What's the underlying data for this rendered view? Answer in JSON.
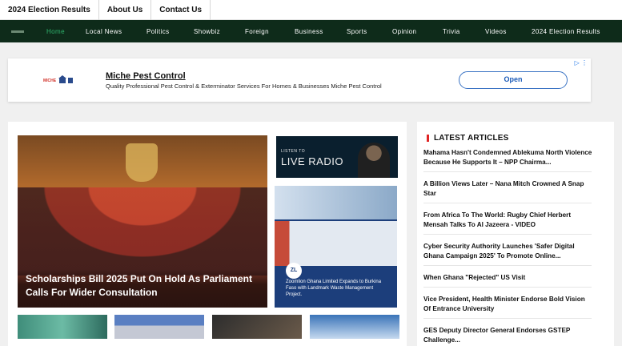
{
  "topbar": {
    "links": [
      "2024 Election Results",
      "About Us",
      "Contact Us"
    ]
  },
  "nav": {
    "items": [
      "Home",
      "Local News",
      "Politics",
      "Showbiz",
      "Foreign",
      "Business",
      "Sports",
      "Opinion",
      "Trivia",
      "Videos",
      "2024 Election Results"
    ],
    "active": "Home",
    "active_color": "#2fb46e",
    "bg_color": "#0e2b1a"
  },
  "ad": {
    "logo": "Miche Pest Control",
    "title": "Miche Pest Control",
    "text": "Quality Professional Pest Control & Exterminator Services For Homes & Businesses Miche Pest Control",
    "button": "Open",
    "flags_icon": "adchoices-icon"
  },
  "feature": {
    "caption": "Scholarships Bill 2025 Put On Hold As Parliament Calls For Wider Consultation"
  },
  "radio": {
    "listen": "LISTEN TO",
    "live": "LIVE RADIO"
  },
  "promo": {
    "badge": "ZL",
    "text": "Zoomlion Ghana Limited Expands to Burkina Faso with Landmark Waste Management Project."
  },
  "sidebar": {
    "title": "LATEST ARTICLES",
    "accent_color": "#e02424",
    "articles": [
      "Mahama Hasn't Condemned Ablekuma North Violence Because He Supports It – NPP Chairma...",
      "A Billion Views Later – Nana Mitch Crowned A Snap Star",
      "From Africa To The World: Rugby Chief Herbert Mensah Talks To Al Jazeera - VIDEO",
      "Cyber Security Authority Launches 'Safer Digital Ghana Campaign 2025' To Promote Online...",
      "When Ghana \"Rejected\" US Visit",
      "Vice President, Health Minister Endorse Bold Vision Of Entrance University",
      "GES Deputy Director General Endorses GSTEP Challenge..."
    ]
  }
}
